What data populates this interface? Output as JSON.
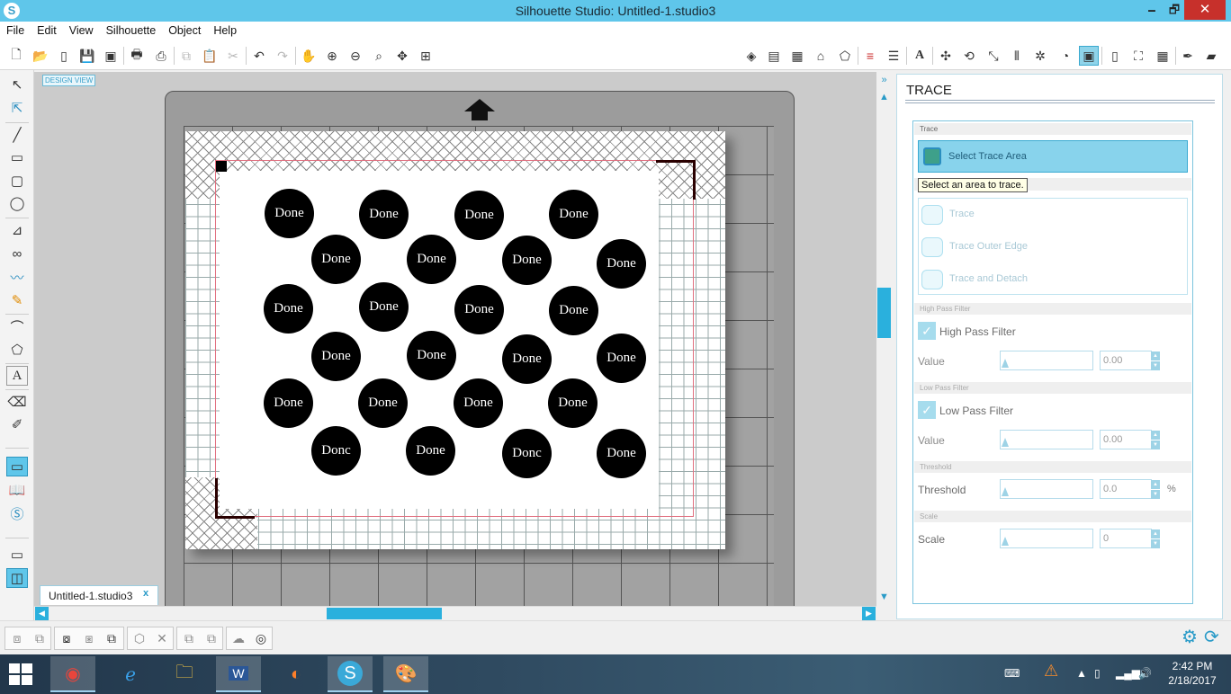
{
  "window": {
    "title": "Silhouette Studio: Untitled-1.studio3",
    "minimize": "🗕",
    "maximize": "🗗",
    "close": "✕"
  },
  "menu": [
    "File",
    "Edit",
    "View",
    "Silhouette",
    "Object",
    "Help"
  ],
  "canvas": {
    "design_view_label": "DESIGN VIEW",
    "circle_labels": [
      "Done",
      "Done",
      "Done",
      "Done",
      "Done",
      "Done",
      "Done",
      "Done",
      "Done",
      "Done",
      "Done",
      "Done",
      "Done",
      "Done",
      "Done",
      "Done",
      "Done",
      "Done",
      "Done",
      "Done",
      "Donc",
      "Done",
      "Donc",
      "Done"
    ]
  },
  "document_tab": {
    "label": "Untitled-1.studio3",
    "close": "x"
  },
  "panel": {
    "title": "TRACE",
    "section_trace": "Trace",
    "select_trace_area": "Select Trace Area",
    "tooltip": "Select an area to trace.",
    "trace_buttons": [
      "Trace",
      "Trace Outer Edge",
      "Trace and Detach"
    ],
    "section_high_pass": "High Pass Filter",
    "high_pass_label": "High Pass Filter",
    "high_pass_value_label": "Value",
    "high_pass_value": "0.00",
    "section_low_pass": "Low Pass Filter",
    "low_pass_label": "Low Pass Filter",
    "low_pass_value_label": "Value",
    "low_pass_value": "0.00",
    "section_threshold": "Threshold",
    "threshold_label": "Threshold",
    "threshold_value": "0.0",
    "threshold_unit": "%",
    "section_scale": "Scale",
    "scale_label": "Scale",
    "scale_value": "0"
  },
  "taskbar": {
    "time": "2:42 PM",
    "date": "2/18/2017"
  }
}
